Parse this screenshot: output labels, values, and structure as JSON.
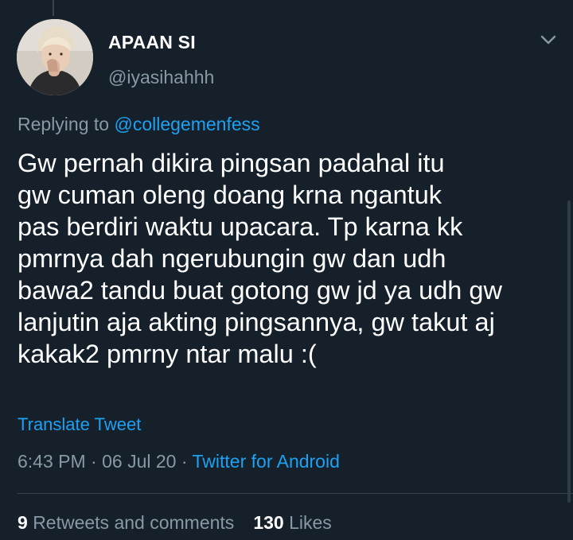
{
  "tweet": {
    "author": {
      "display_name": "APAAN SI",
      "handle": "@iyasihahhh"
    },
    "reply_context": {
      "prefix": "Replying to",
      "mention": "@collegemenfess"
    },
    "text_lines": [
      "Gw pernah dikira pingsan padahal itu",
      "gw cuman oleng doang krna ngantuk",
      "pas berdiri waktu upacara. Tp karna kk",
      "pmrnya dah ngerubungin gw dan udh",
      "bawa2 tandu buat gotong gw jd ya udh gw",
      "lanjutin aja akting pingsannya, gw takut aj",
      "kakak2  pmrny ntar malu :("
    ],
    "translate_label": "Translate Tweet",
    "time": "6:43 PM",
    "date": "06 Jul 20",
    "separator": "·",
    "source": "Twitter for Android",
    "stats": {
      "retweets_count": "9",
      "retweets_label": "Retweets and comments",
      "likes_count": "130",
      "likes_label": "Likes"
    }
  },
  "icons": {
    "menu": "chevron-down-icon"
  },
  "colors": {
    "background": "#15202b",
    "text_primary": "#ffffff",
    "text_secondary": "#8899a6",
    "accent": "#1da1f2",
    "divider": "#38444d"
  }
}
